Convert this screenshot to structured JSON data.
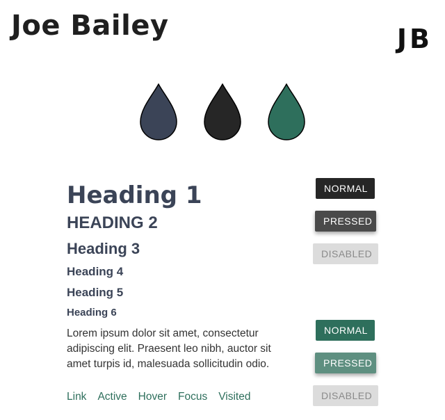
{
  "header": {
    "name": "Joe Bailey",
    "monogram": "JB"
  },
  "palette": {
    "swatches": [
      {
        "name": "slate",
        "color": "#3b4457"
      },
      {
        "name": "charcoal",
        "color": "#262626"
      },
      {
        "name": "green",
        "color": "#2e6f5c"
      }
    ]
  },
  "typography": {
    "h1": "Heading 1",
    "h2": "HEADING 2",
    "h3": "Heading 3",
    "h4": "Heading 4",
    "h5": "Heading 5",
    "h6": "Heading 6",
    "paragraph": "Lorem ipsum dolor sit amet, consectetur adipiscing elit. Praesent leo nibh, auctor sit amet turpis id, malesuada sollicitudin odio.",
    "links": [
      "Link",
      "Active",
      "Hover",
      "Focus",
      "Visited"
    ]
  },
  "buttons": {
    "dark": {
      "normal": "NORMAL",
      "pressed": "PRESSED",
      "disabled": "DISABLED"
    },
    "green": {
      "normal": "NORMAL",
      "pressed": "PRESSED",
      "disabled": "DISABLED"
    }
  }
}
